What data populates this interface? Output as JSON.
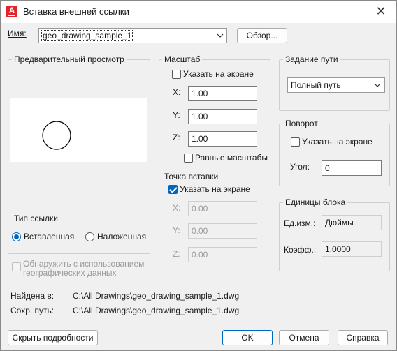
{
  "window": {
    "title": "Вставка внешней ссылки",
    "app_icon_letter": "A"
  },
  "name_field": {
    "label": "Имя:",
    "value": "geo_drawing_sample_1",
    "browse_label": "Обзор..."
  },
  "preview": {
    "title": "Предварительный просмотр"
  },
  "scale": {
    "title": "Масштаб",
    "specify_on_screen": "Указать на экране",
    "x_label": "X:",
    "x_value": "1.00",
    "y_label": "Y:",
    "y_value": "1.00",
    "z_label": "Z:",
    "z_value": "1.00",
    "uniform": "Равные масштабы"
  },
  "insertion": {
    "title": "Точка вставки",
    "specify_on_screen": "Указать на экране",
    "x_label": "X:",
    "x_value": "0.00",
    "y_label": "Y:",
    "y_value": "0.00",
    "z_label": "Z:",
    "z_value": "0.00"
  },
  "path_type": {
    "title": "Задание пути",
    "value": "Полный путь"
  },
  "rotation": {
    "title": "Поворот",
    "specify_on_screen": "Указать на экране",
    "angle_label": "Угол:",
    "angle_value": "0"
  },
  "block_units": {
    "title": "Единицы блока",
    "unit_label": "Ед.изм.:",
    "unit_value": "Дюймы",
    "factor_label": "Коэфф.:",
    "factor_value": "1.0000"
  },
  "reference_type": {
    "title": "Тип ссылки",
    "attach": "Вставленная",
    "overlay": "Наложенная"
  },
  "geo_checkbox": {
    "line1": "Обнаружить с использованием",
    "line2": "географических данных"
  },
  "info": {
    "found_label": "Найдена в:",
    "found_value": "C:\\All Drawings\\geo_drawing_sample_1.dwg",
    "saved_label": "Сохр. путь:",
    "saved_value": "C:\\All Drawings\\geo_drawing_sample_1.dwg"
  },
  "buttons": {
    "hide_details": "Скрыть подробности",
    "ok": "OK",
    "cancel": "Отмена",
    "help": "Справка"
  },
  "colors": {
    "accent": "#0067c0",
    "app_icon": "#e3242b"
  }
}
